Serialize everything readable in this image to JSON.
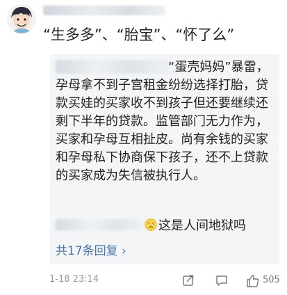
{
  "comment": {
    "avatar_icon": "avatar-icon",
    "text": "“生多多”、“胎宝”、“怀了么”"
  },
  "reply": {
    "text": "“蛋壳妈妈”暴雷，孕母拿不到子宫租金纷纷选择打胎，贷款买娃的买家收不到孩子但还要继续还剩下半年的贷款。监管部门无力作为，买家和孕母互相扯皮。尚有余钱的买家和孕母私下协商保下孩子，还不上贷款的买家成为失信被执行人。",
    "sub_reply_text": "这是人间地狱吗",
    "view_replies": "共17条回复 ›"
  },
  "footer": {
    "timestamp": "1-18 23:14",
    "like_count": "505",
    "icons": [
      "share-icon",
      "comment-icon",
      "like-icon"
    ]
  },
  "colors": {
    "link": "#4a77b0",
    "reply_bg": "#f4f5f7",
    "muted": "#999999"
  }
}
